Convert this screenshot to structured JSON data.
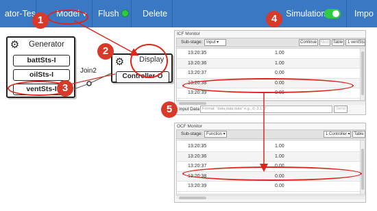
{
  "nav": {
    "title": "ator-Tes",
    "model": "Model",
    "flush": "Flush",
    "delete": "Delete",
    "simulation": "Simulation",
    "import": "Impo"
  },
  "canvas": {
    "generator": {
      "title": "Generator",
      "ports": [
        "battSts-I",
        "oilSts-I",
        "ventSts-I"
      ]
    },
    "join_label": "Join2",
    "display": {
      "title": "Display",
      "port": "Controller-O"
    }
  },
  "icf": {
    "title": "ICF Monitor",
    "sub_stage_label": "Sub-stage:",
    "sub_stage_value": "Input",
    "continue": "Continue",
    "next": "Next",
    "table": "Table",
    "selector": "1 ventSts",
    "rows": [
      {
        "time": "13:20:35",
        "value": "1.00"
      },
      {
        "time": "13:20:36",
        "value": "1.00"
      },
      {
        "time": "13:20:37",
        "value": "0.00"
      },
      {
        "time": "13:20:38",
        "value": "0.00"
      },
      {
        "time": "13:20:39",
        "value": "0.00"
      }
    ],
    "input_label": "Input Data",
    "input_placeholder": "Format: \"data;data;data\" e.g., 0; 3.1; 7",
    "send": "Send"
  },
  "ocf": {
    "title": "OCF Monitor",
    "sub_stage_label": "Sub-stage:",
    "sub_stage_value": "Function",
    "selector": "1 Controller",
    "table": "Table",
    "rows": [
      {
        "time": "13:20:35",
        "value": "1.00"
      },
      {
        "time": "13:20:36",
        "value": "1.00"
      },
      {
        "time": "13:20:37",
        "value": "0.00"
      },
      {
        "time": "13:20:38",
        "value": "0.00"
      },
      {
        "time": "13:20:39",
        "value": "0.00"
      }
    ]
  },
  "annotations": {
    "badges": [
      "1",
      "2",
      "3",
      "4",
      "5"
    ]
  },
  "colors": {
    "nav_bg": "#3a78c4",
    "badge": "#d83a2a",
    "highlight": "#e0241a",
    "toggle_on": "#2ecc40"
  }
}
